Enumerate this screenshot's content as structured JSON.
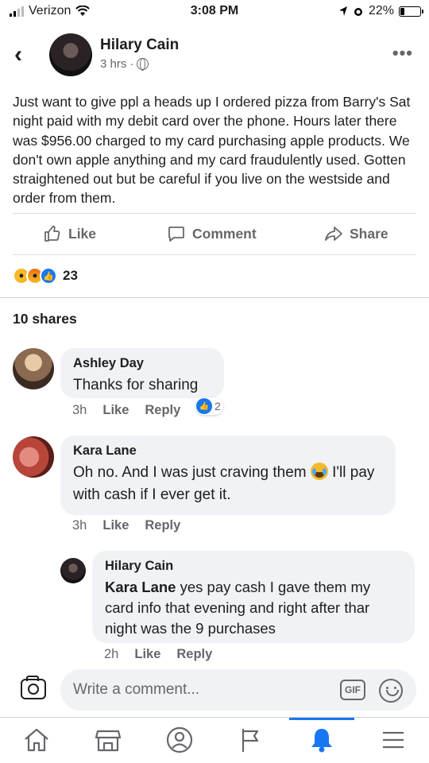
{
  "status_bar": {
    "carrier": "Verizon",
    "time": "3:08 PM",
    "battery": "22%",
    "battery_level": 0.22
  },
  "post": {
    "author": "Hilary Cain",
    "timestamp": "3 hrs",
    "separator": "·",
    "text": "Just want to give ppl a heads up I ordered pizza from Barry's Sat night paid with my debit card over the phone. Hours later there was $956.00 charged to my card purchasing apple products. We don't own apple anything and my card fraudulently used. Gotten straightened out but be careful if you live on the westside and order from them.",
    "actions": {
      "like": "Like",
      "comment": "Comment",
      "share": "Share"
    },
    "reaction_count": "23",
    "shares": "10 shares"
  },
  "comments": [
    {
      "author": "Ashley Day",
      "text": "Thanks for sharing",
      "time": "3h",
      "like": "Like",
      "reply": "Reply",
      "like_count": "2"
    },
    {
      "author": "Kara Lane",
      "text_before": "Oh no.  And I was just craving them ",
      "text_after": " I'll pay with cash if I ever get it.",
      "time": "3h",
      "like": "Like",
      "reply": "Reply"
    }
  ],
  "reply": {
    "author": "Hilary Cain",
    "mention": "Kara Lane",
    "text": " yes pay cash I gave them my card info that evening and right after thar night was the 9 purchases",
    "time": "2h",
    "like": "Like",
    "reply": "Reply"
  },
  "composer": {
    "placeholder": "Write a comment...",
    "gif": "GIF"
  },
  "colors": {
    "accent": "#1877f2",
    "bubble": "#f0f2f5",
    "secondary_text": "#65676b"
  },
  "icons": [
    "back-icon",
    "globe-icon",
    "more-icon",
    "like-icon",
    "comment-icon",
    "share-icon",
    "camera-icon",
    "gif-icon",
    "emoji-icon",
    "home-icon",
    "marketplace-icon",
    "profile-icon",
    "pages-icon",
    "notifications-icon",
    "menu-icon"
  ]
}
